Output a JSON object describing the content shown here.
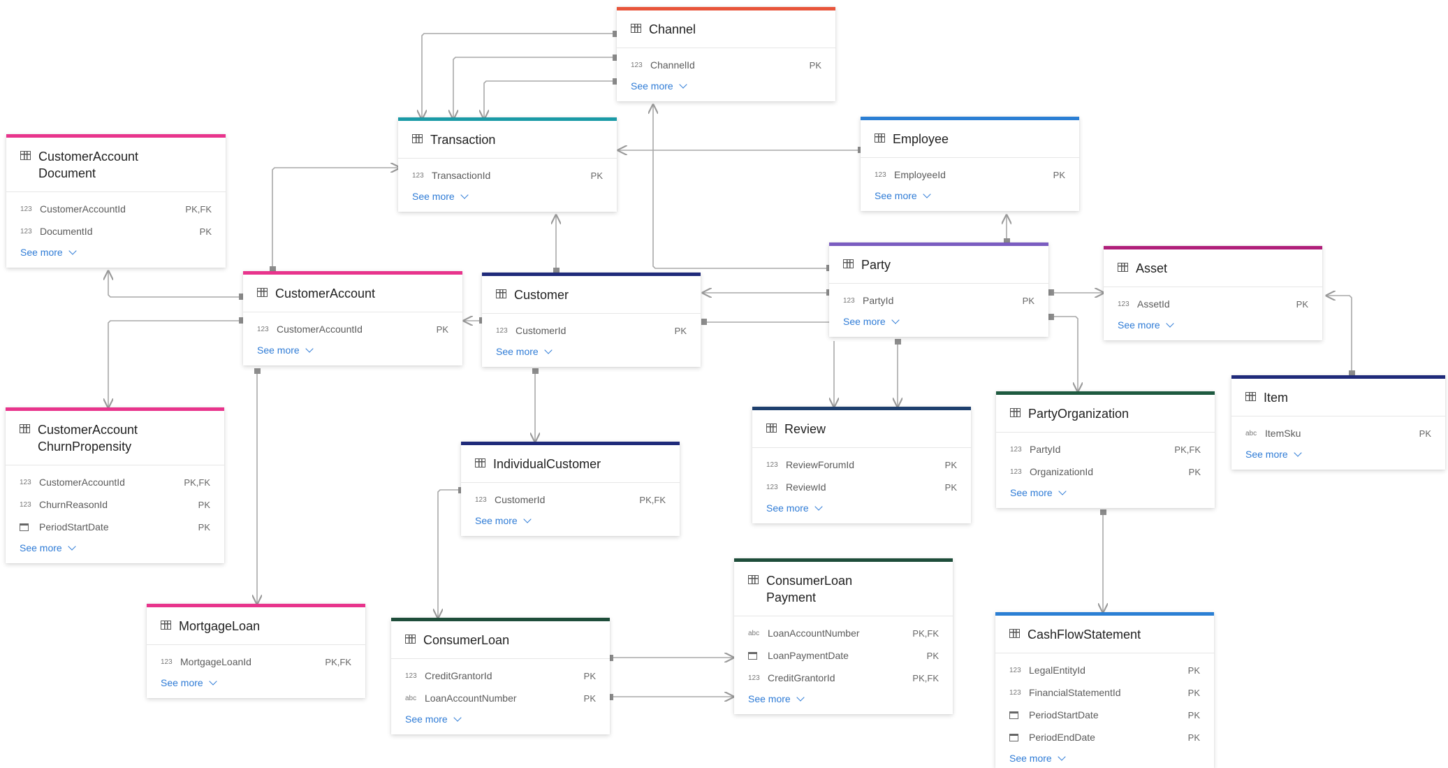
{
  "entities": {
    "channel": {
      "title": "Channel",
      "fields": [
        {
          "type": "123",
          "name": "ChannelId",
          "key": "PK"
        }
      ],
      "see_more": "See more",
      "accent": "#e8553b"
    },
    "transaction": {
      "title": "Transaction",
      "fields": [
        {
          "type": "123",
          "name": "TransactionId",
          "key": "PK"
        }
      ],
      "see_more": "See more",
      "accent": "#1a9aa6"
    },
    "employee": {
      "title": "Employee",
      "fields": [
        {
          "type": "123",
          "name": "EmployeeId",
          "key": "PK"
        }
      ],
      "see_more": "See more",
      "accent": "#2b7fd4"
    },
    "customer_account_document": {
      "title": "CustomerAccount Document",
      "fields": [
        {
          "type": "123",
          "name": "CustomerAccountId",
          "key": "PK,FK"
        },
        {
          "type": "123",
          "name": "DocumentId",
          "key": "PK"
        }
      ],
      "see_more": "See more",
      "accent": "#e8348c"
    },
    "customer_account": {
      "title": "CustomerAccount",
      "fields": [
        {
          "type": "123",
          "name": "CustomerAccountId",
          "key": "PK"
        }
      ],
      "see_more": "See more",
      "accent": "#e8348c"
    },
    "customer": {
      "title": "Customer",
      "fields": [
        {
          "type": "123",
          "name": "CustomerId",
          "key": "PK"
        }
      ],
      "see_more": "See more",
      "accent": "#1f2a7a"
    },
    "party": {
      "title": "Party",
      "fields": [
        {
          "type": "123",
          "name": "PartyId",
          "key": "PK"
        }
      ],
      "see_more": "See more",
      "accent": "#7a5cc0"
    },
    "asset": {
      "title": "Asset",
      "fields": [
        {
          "type": "123",
          "name": "AssetId",
          "key": "PK"
        }
      ],
      "see_more": "See more",
      "accent": "#b01f7a"
    },
    "customer_account_churn": {
      "title": "CustomerAccount ChurnPropensity",
      "fields": [
        {
          "type": "123",
          "name": "CustomerAccountId",
          "key": "PK,FK"
        },
        {
          "type": "123",
          "name": "ChurnReasonId",
          "key": "PK"
        },
        {
          "type": "date",
          "name": "PeriodStartDate",
          "key": "PK"
        }
      ],
      "see_more": "See more",
      "accent": "#e8348c"
    },
    "individual_customer": {
      "title": "IndividualCustomer",
      "fields": [
        {
          "type": "123",
          "name": "CustomerId",
          "key": "PK,FK"
        }
      ],
      "see_more": "See more",
      "accent": "#1f2a7a"
    },
    "review": {
      "title": "Review",
      "fields": [
        {
          "type": "123",
          "name": "ReviewForumId",
          "key": "PK"
        },
        {
          "type": "123",
          "name": "ReviewId",
          "key": "PK"
        }
      ],
      "see_more": "See more",
      "accent": "#1e3f6e"
    },
    "party_organization": {
      "title": "PartyOrganization",
      "fields": [
        {
          "type": "123",
          "name": "PartyId",
          "key": "PK,FK"
        },
        {
          "type": "123",
          "name": "OrganizationId",
          "key": "PK"
        }
      ],
      "see_more": "See more",
      "accent": "#1e5a40"
    },
    "item": {
      "title": "Item",
      "fields": [
        {
          "type": "abc",
          "name": "ItemSku",
          "key": "PK"
        }
      ],
      "see_more": "See more",
      "accent": "#1f2a7a"
    },
    "mortgage_loan": {
      "title": "MortgageLoan",
      "fields": [
        {
          "type": "123",
          "name": "MortgageLoanId",
          "key": "PK,FK"
        }
      ],
      "see_more": "See more",
      "accent": "#e8348c"
    },
    "consumer_loan": {
      "title": "ConsumerLoan",
      "fields": [
        {
          "type": "123",
          "name": "CreditGrantorId",
          "key": "PK"
        },
        {
          "type": "abc",
          "name": "LoanAccountNumber",
          "key": "PK"
        }
      ],
      "see_more": "See more",
      "accent": "#1e4d3a"
    },
    "consumer_loan_payment": {
      "title": "ConsumerLoan Payment",
      "fields": [
        {
          "type": "abc",
          "name": "LoanAccountNumber",
          "key": "PK,FK"
        },
        {
          "type": "date",
          "name": "LoanPaymentDate",
          "key": "PK"
        },
        {
          "type": "123",
          "name": "CreditGrantorId",
          "key": "PK,FK"
        }
      ],
      "see_more": "See more",
      "accent": "#1e4d3a"
    },
    "cash_flow_statement": {
      "title": "CashFlowStatement",
      "fields": [
        {
          "type": "123",
          "name": "LegalEntityId",
          "key": "PK"
        },
        {
          "type": "123",
          "name": "FinancialStatementId",
          "key": "PK"
        },
        {
          "type": "date",
          "name": "PeriodStartDate",
          "key": "PK"
        },
        {
          "type": "date",
          "name": "PeriodEndDate",
          "key": "PK"
        }
      ],
      "see_more": "See more",
      "accent": "#2b7fd4"
    }
  }
}
